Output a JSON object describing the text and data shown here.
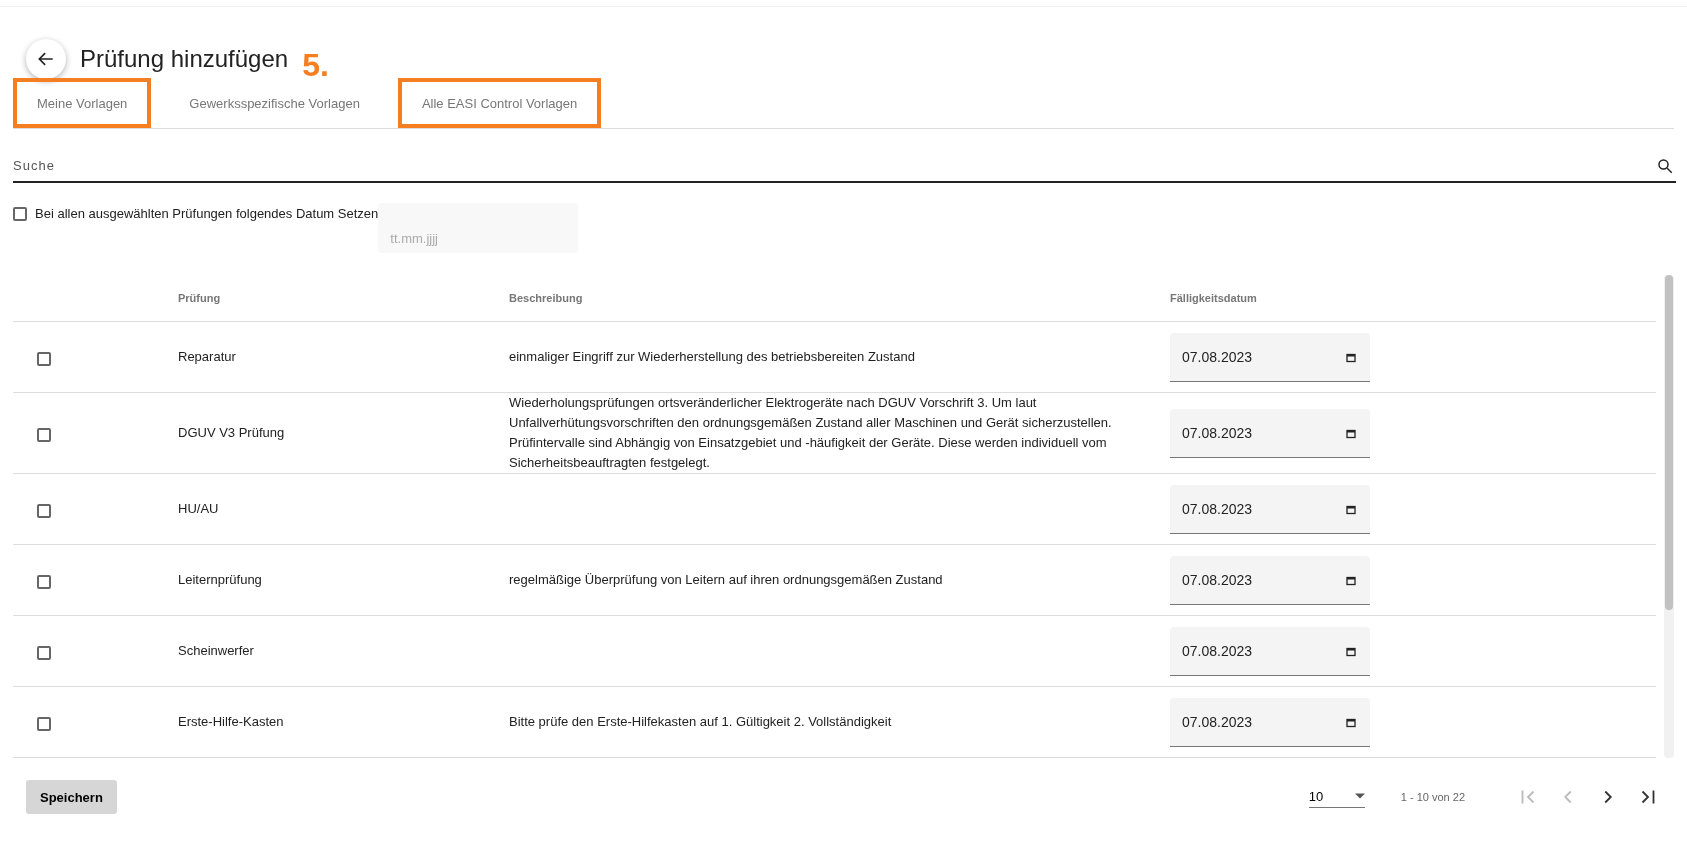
{
  "header": {
    "title": "Prüfung hinzufügen",
    "annotation": "5."
  },
  "tabs": [
    {
      "label": "Meine Vorlagen",
      "selected": false,
      "highlighted": true
    },
    {
      "label": "Gewerksspezifische Vorlagen",
      "selected": false,
      "highlighted": false
    },
    {
      "label": "Alle EASI Control Vorlagen",
      "selected": false,
      "highlighted": true
    }
  ],
  "search": {
    "placeholder": "Suche"
  },
  "bulk_date": {
    "label": "Bei allen ausgewählten Prüfungen folgendes Datum Setzen",
    "checked": false,
    "placeholder": "tt.mm.jjjj"
  },
  "table": {
    "columns": [
      "Prüfung",
      "Beschreibung",
      "Fälligkeitsdatum"
    ],
    "rows": [
      {
        "checked": false,
        "name": "Reparatur",
        "description": "einmaliger Eingriff zur Wiederherstellung des betriebsbereiten Zustand",
        "due_date": "07.08.2023"
      },
      {
        "checked": false,
        "name": "DGUV V3 Prüfung",
        "description": "Wiederholungsprüfungen ortsveränderlicher Elektrogeräte nach DGUV Vorschrift 3. Um laut Unfallverhütungsvorschriften den ordnungsgemäßen Zustand aller Maschinen und Gerät sicherzustellen. Prüfintervalle sind Abhängig von Einsatzgebiet und -häufigkeit der Geräte. Diese werden individuell vom Sicherheitsbeauftragten festgelegt.",
        "due_date": "07.08.2023"
      },
      {
        "checked": false,
        "name": "HU/AU",
        "description": "",
        "due_date": "07.08.2023"
      },
      {
        "checked": false,
        "name": "Leiternprüfung",
        "description": "regelmäßige Überprüfung von Leitern auf ihren ordnungsgemäßen Zustand",
        "due_date": "07.08.2023"
      },
      {
        "checked": false,
        "name": "Scheinwerfer",
        "description": "",
        "due_date": "07.08.2023"
      },
      {
        "checked": false,
        "name": "Erste-Hilfe-Kasten",
        "description": "Bitte prüfe den Erste-Hilfekasten auf 1. Gültigkeit 2. Vollständigkeit",
        "due_date": "07.08.2023"
      }
    ]
  },
  "footer": {
    "save_button": "Speichern",
    "page_size": "10",
    "range": "1 - 10 von 22",
    "nav": [
      {
        "kind": "first",
        "disabled": true
      },
      {
        "kind": "prev",
        "disabled": true
      },
      {
        "kind": "next",
        "disabled": false
      },
      {
        "kind": "last",
        "disabled": false
      }
    ]
  }
}
